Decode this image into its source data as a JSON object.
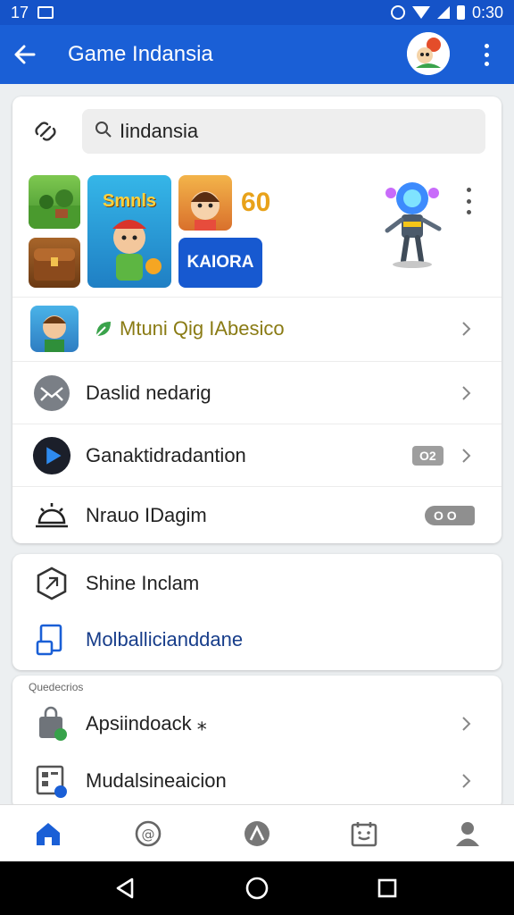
{
  "status_bar": {
    "left_text": "17",
    "time": "0:30"
  },
  "app_bar": {
    "title": "Game Indansia"
  },
  "search": {
    "value": "Iindansia"
  },
  "games": {
    "tiles": [
      "Smnls",
      "KAIORA"
    ],
    "score": "60"
  },
  "list1": [
    {
      "label": "Mtuni Qig IAbesico",
      "icon": "game-character-icon"
    },
    {
      "label": "Daslid nedarig",
      "icon": "mail-badge-icon"
    },
    {
      "label": "Ganaktidradantion",
      "icon": "play-store-icon",
      "badge": "O2"
    },
    {
      "label": "Nrauo IDagim",
      "icon": "sunrise-icon",
      "badge": "O O"
    }
  ],
  "list2": [
    {
      "label": "Shine Inclam",
      "icon": "shield-icon"
    },
    {
      "label": "Molballicianddane",
      "icon": "device-icon"
    }
  ],
  "section3": {
    "header": "Quedecrios",
    "items": [
      {
        "label": "Apsiindoack ⁎",
        "icon": "bag-icon"
      },
      {
        "label": "Mudalsineaicion",
        "icon": "grid-app-icon"
      }
    ]
  },
  "bottom_nav": [
    "home",
    "mention",
    "explore",
    "calendar",
    "profile"
  ],
  "colors": {
    "primary": "#1a5fd6",
    "status": "#1553c8",
    "score": "#e8a21a"
  }
}
